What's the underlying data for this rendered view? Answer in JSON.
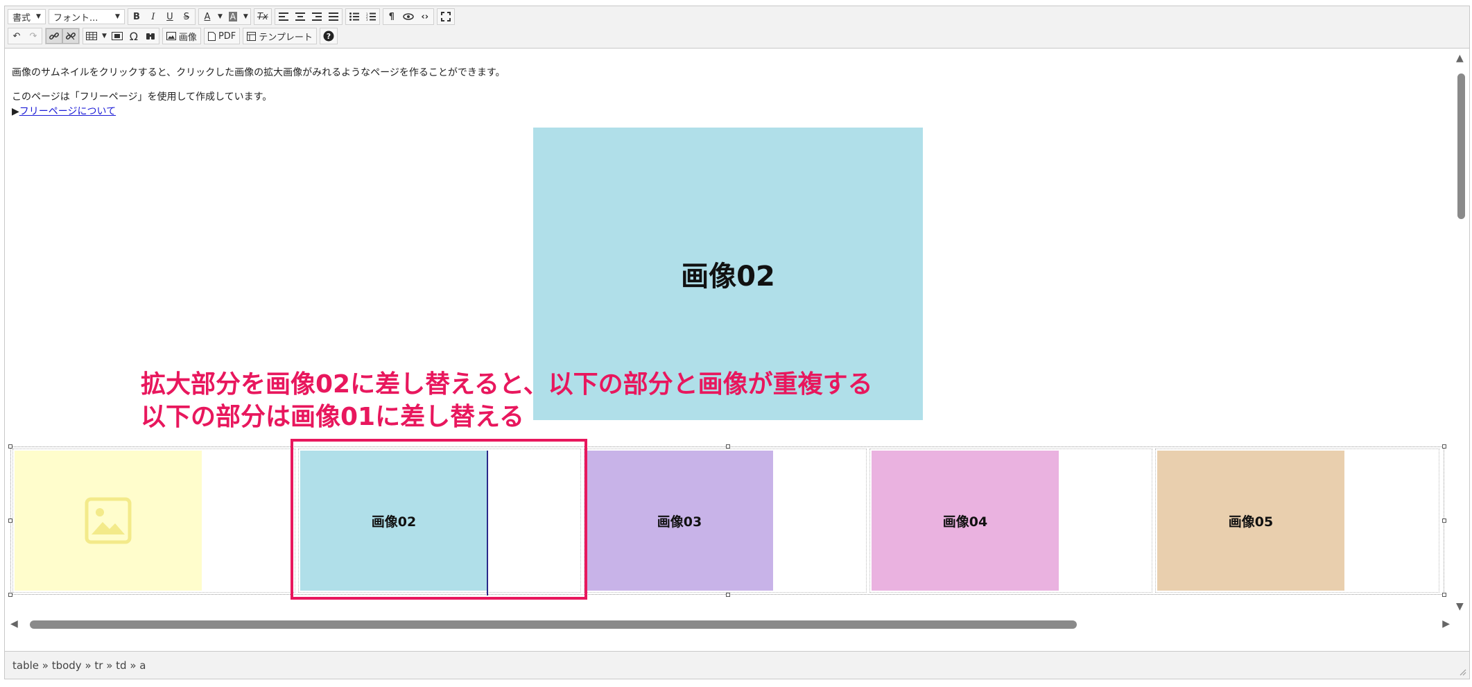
{
  "toolbar": {
    "format_label": "書式",
    "font_label": "フォント...",
    "image_label": "画像",
    "pdf_label": "PDF",
    "template_label": "テンプレート"
  },
  "content": {
    "line1": "画像のサムネイルをクリックすると、クリックした画像の拡大画像がみれるようなページを作ることができます。",
    "line2": "このページは「フリーページ」を使用して作成しています。",
    "link_prefix": "▶",
    "link_text": "フリーページについて",
    "big_image_label": "画像02",
    "thumbnails": [
      {
        "label": "",
        "color": "#fffdcc",
        "placeholder": true
      },
      {
        "label": "画像02",
        "color": "#b0dfe9"
      },
      {
        "label": "画像03",
        "color": "#c8b3e8"
      },
      {
        "label": "画像04",
        "color": "#eab2e0"
      },
      {
        "label": "画像05",
        "color": "#e9cfae"
      }
    ]
  },
  "annotation": {
    "line1": "拡大部分を画像02に差し替えると、以下の部分と画像が重複する",
    "line2": "以下の部分は画像01に差し替える",
    "color": "#e8175d"
  },
  "statusbar": {
    "path": "table » tbody » tr » td » a"
  }
}
